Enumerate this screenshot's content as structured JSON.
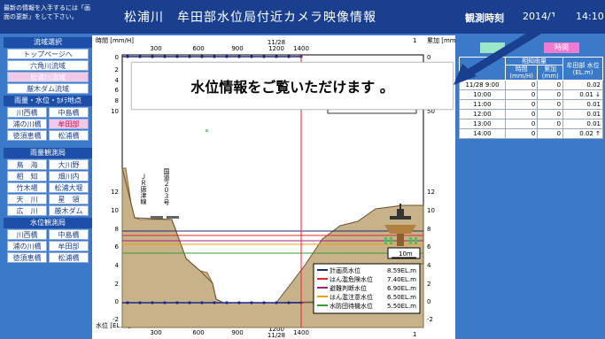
{
  "header": {
    "note": "最新の情報を入手するには「画面の更新」をして下さい。",
    "title": "松浦川　牟田部水位局付近カメラ映像情報",
    "time_label": "観測時刻",
    "time_value": "2014/1",
    "time_clock": "14:10"
  },
  "sidebar": {
    "basin_heading": "流域選択",
    "basin_items": [
      "トップページへ",
      "六角川流域",
      "松浦川流域",
      "厳木ダム流域"
    ],
    "rain_heading": "雨量・水位・ｶﾒﾗ地点",
    "rain_items": [
      [
        "川西橋",
        "中島橋"
      ],
      [
        "浦の川橋",
        "牟田部"
      ],
      [
        "徳須恵橋",
        "松浦橋"
      ]
    ],
    "rain_station_heading": "雨量観測局",
    "rain_station_items": [
      [
        "鳥　海",
        "大川野"
      ],
      [
        "相　知",
        "畑川内"
      ],
      [
        "竹木場",
        "松浦大堰"
      ],
      [
        "天　川",
        "星　領"
      ],
      [
        "広　川",
        "厳木ダム"
      ]
    ],
    "water_station_heading": "水位観測局",
    "water_station_items": [
      [
        "川西橋",
        "中島橋"
      ],
      [
        "浦の川橋",
        "牟田部"
      ],
      [
        "徳須恵橋",
        "松浦橋"
      ]
    ]
  },
  "popup": {
    "text": "水位情報をご覧いただけます 。"
  },
  "right": {
    "tab_a": "",
    "tab_b": "時間",
    "table": {
      "group_header": "相知雨量",
      "col_hourly": "時間 (mm/H)",
      "col_cumulative": "累加 (mm)",
      "col_level": "牟田部 水位 (EL.m)",
      "rows": [
        {
          "time": "11/28  9:00",
          "hourly": "0",
          "cum": "0",
          "level": "0.02",
          "trend": ""
        },
        {
          "time": "10:00",
          "hourly": "0",
          "cum": "0",
          "level": "0.01",
          "trend": "↓"
        },
        {
          "time": "11:00",
          "hourly": "0",
          "cum": "0",
          "level": "0.01",
          "trend": ""
        },
        {
          "time": "12:00",
          "hourly": "0",
          "cum": "0",
          "level": "0.01",
          "trend": ""
        },
        {
          "time": "13:00",
          "hourly": "0",
          "cum": "0",
          "level": "0.01",
          "trend": ""
        },
        {
          "time": "14:00",
          "hourly": "0",
          "cum": "0",
          "level": "0.02",
          "trend": "↑"
        }
      ]
    }
  },
  "chart": {
    "rain_axis_label": "時間 [mm/H]",
    "cum_axis_label": "累加 [mm]",
    "level_axis_label": "水位 [EL.m]",
    "time_ticks": [
      "300",
      "600",
      "900",
      "1200",
      "1400"
    ],
    "time_date": "11/28",
    "left_ticks_top": [
      "0",
      "2",
      "4",
      "6",
      "8",
      "10"
    ],
    "left_ticks_bottom": [
      "12",
      "10",
      "8",
      "6",
      "4",
      "2",
      "0",
      "-2"
    ],
    "right_ticks_top": [
      "0",
      "10",
      "20",
      "30",
      "40",
      "50"
    ],
    "right_ticks_bottom": [
      "12",
      "10",
      "8",
      "6",
      "4",
      "2",
      "0",
      "-2"
    ],
    "label_left": "ＪＲ唐津線",
    "label_right": "国道２０３号",
    "scale": "10m",
    "legend": [
      {
        "label": "計画高水位",
        "value": "8.59EL.m",
        "color": "#1b2a6b"
      },
      {
        "label": "はん濫危険水位",
        "value": "7.40EL.m",
        "color": "#e02828"
      },
      {
        "label": "避難判断水位",
        "value": "6.90EL.m",
        "color": "#a02080"
      },
      {
        "label": "はん濫注意水位",
        "value": "6.50EL.m",
        "color": "#f0a000"
      },
      {
        "label": "水防団待機水位",
        "value": "5.50EL.m",
        "color": "#30a030"
      }
    ],
    "number_1_top": "1",
    "number_1_bottom": "1"
  }
}
